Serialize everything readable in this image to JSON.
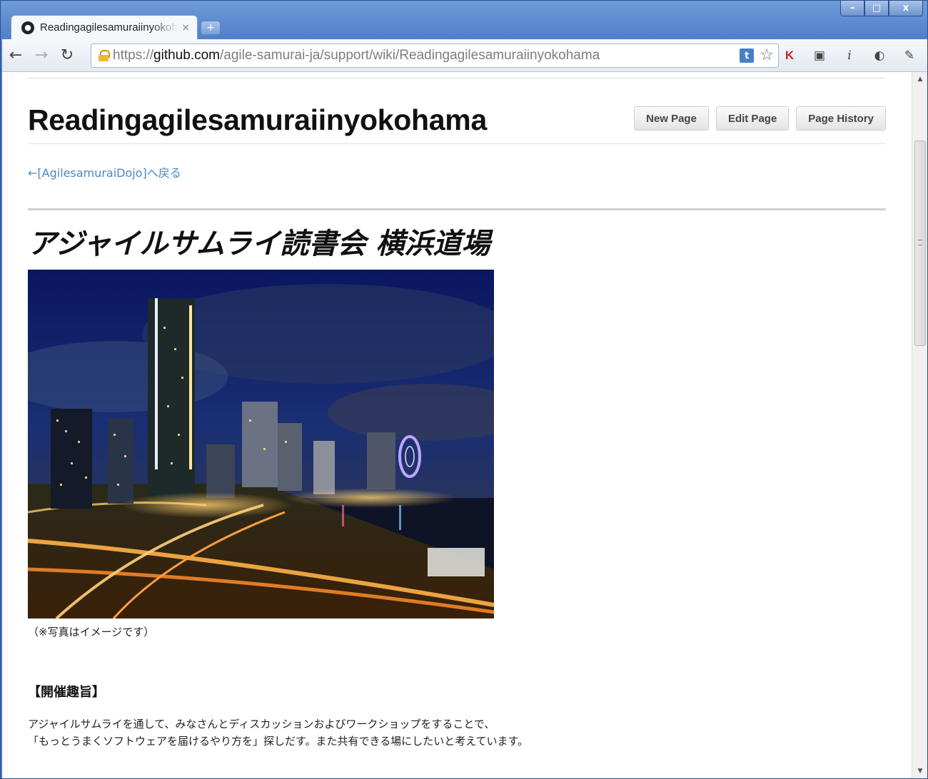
{
  "browser": {
    "tab_title": "Readingagilesamuraiinyokohama",
    "tab_close": "×",
    "new_tab": "+",
    "url_scheme": "https://",
    "url_host": "github.com",
    "url_path": "/agile-samurai-ja/support/wiki/Readingagilesamuraiinyokohama",
    "ext_t": "t",
    "window_buttons": {
      "minimize": "–",
      "maximize": "□",
      "close": "x"
    }
  },
  "page": {
    "title": "Readingagilesamuraiinyokohama",
    "buttons": {
      "new_page": "New Page",
      "edit_page": "Edit Page",
      "page_history": "Page History"
    },
    "back_link": "←[AgilesamuraiDojo]へ戻る",
    "heading": "アジャイルサムライ読書会 横浜道場",
    "photo_caption": "（※写真はイメージです）",
    "section_heading": "【開催趣旨】",
    "paragraph_lines": [
      "アジャイルサムライを通して、みなさんとディスカッションおよびワークショップをすることで、",
      "「もっとうまくソフトウェアを届けるやり方を」探しだす。また共有できる場にしたいと考えています。"
    ]
  },
  "colors": {
    "link": "#4a87c5",
    "window_frame": "#4b7cc6"
  }
}
